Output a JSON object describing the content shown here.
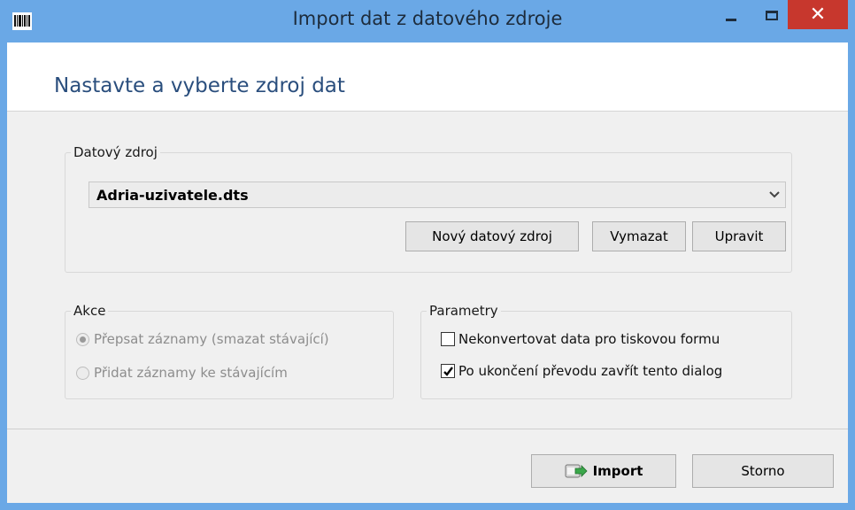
{
  "window": {
    "title": "Import dat z datového zdroje",
    "close_glyph": "✕"
  },
  "header": {
    "title": "Nastavte a vyberte zdroj dat"
  },
  "data_source": {
    "group_label": "Datový zdroj",
    "selected": "Adria-uzivatele.dts",
    "buttons": {
      "new": "Nový datový zdroj",
      "delete": "Vymazat",
      "edit": "Upravit"
    }
  },
  "action": {
    "group_label": "Akce",
    "options": [
      {
        "label": "Přepsat záznamy (smazat stávající)",
        "selected": true
      },
      {
        "label": "Přidat záznamy ke stávajícím",
        "selected": false
      }
    ]
  },
  "parameters": {
    "group_label": "Parametry",
    "options": [
      {
        "label": "Nekonvertovat data pro tiskovou formu",
        "checked": false
      },
      {
        "label": "Po ukončení převodu zavřít tento dialog",
        "checked": true
      }
    ]
  },
  "footer": {
    "import": "Import",
    "cancel": "Storno"
  },
  "colors": {
    "titlebar": "#6aa8e6",
    "close": "#c7372d",
    "header_text": "#2a4e7d"
  }
}
